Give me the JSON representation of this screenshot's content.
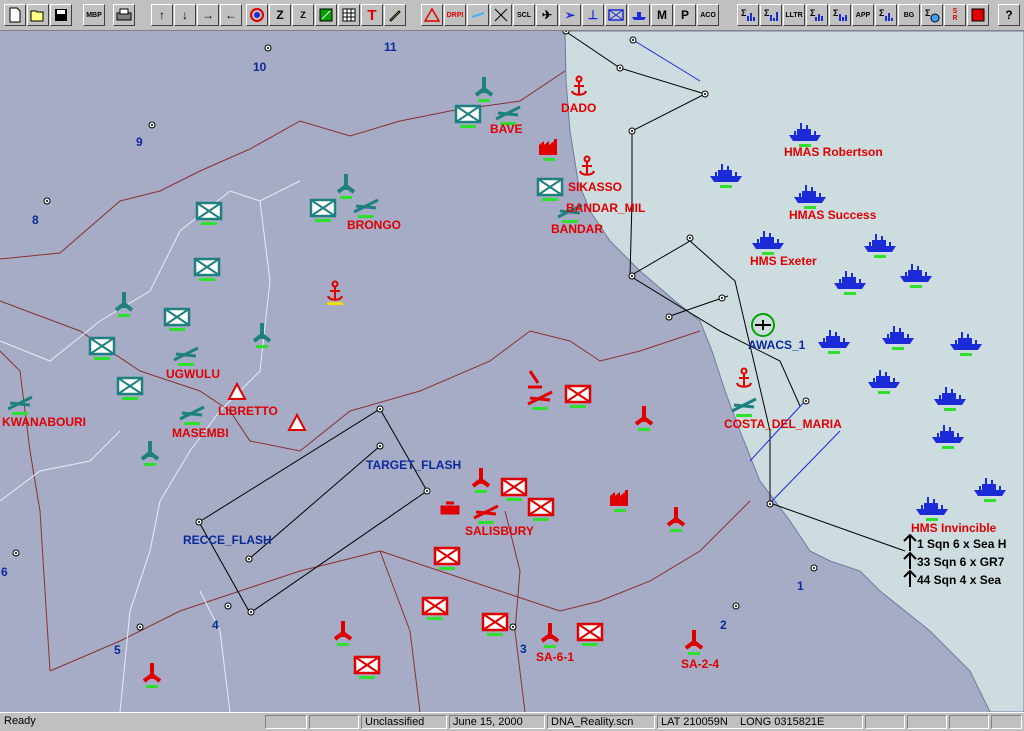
{
  "toolbar": {
    "mbp_label": "MBP",
    "zoom_in_label": "Z",
    "zoom_out_label": "Z",
    "text_label": "T",
    "drpi_label": "DRPI",
    "scl_label": "SCL",
    "m_label": "M",
    "p_label": "P",
    "aco_label": "ACO",
    "lltr_label": "LLTR",
    "app_label": "APP",
    "bg_label": "BG",
    "sr_label": "S\nR",
    "help_label": "?"
  },
  "colors": {
    "land": "#a6acc6",
    "sea": "#cddcdf",
    "red_force": "#e00000",
    "blue_force": "#1b2bd8",
    "neutral": "#1f8080",
    "route": "#000000"
  },
  "map": {
    "grid_numbers": [
      "1",
      "2",
      "3",
      "4",
      "5",
      "6",
      "8",
      "9",
      "10",
      "11"
    ],
    "places": {
      "dado": "DADO",
      "bave": "BAVE",
      "sikasso": "SIKASSO",
      "bandar_mil": "BANDAR_MIL",
      "bandar": "BANDAR",
      "brongo": "BRONGO",
      "ugwulu": "UGWULU",
      "libretto": "LIBRETTO",
      "masembi": "MASEMBI",
      "kwanabouri": "KWANABOURI",
      "costa_del_maria": "COSTA_DEL_MARIA",
      "salisbury": "SALISBURY",
      "sa61": "SA-6-1",
      "sa24": "SA-2-4"
    },
    "routes": {
      "target_flash": "TARGET_FLASH",
      "recce_flash": "RECCE_FLASH"
    },
    "ships": {
      "robertson": "HMAS Robertson",
      "success": "HMAS Success",
      "exeter": "HMS Exeter",
      "invincible": "HMS Invincible"
    },
    "awacs": "AWACS_1",
    "squadrons": [
      "1 Sqn  6 x Sea H",
      "33 Sqn  6 x GR7",
      "44 Sqn  4 x Sea"
    ]
  },
  "status": {
    "ready": "Ready",
    "classification": "Unclassified",
    "date": "June 15, 2000",
    "file": "DNA_Reality.scn",
    "lat": "LAT 210059N",
    "long": "LONG 0315821E"
  }
}
